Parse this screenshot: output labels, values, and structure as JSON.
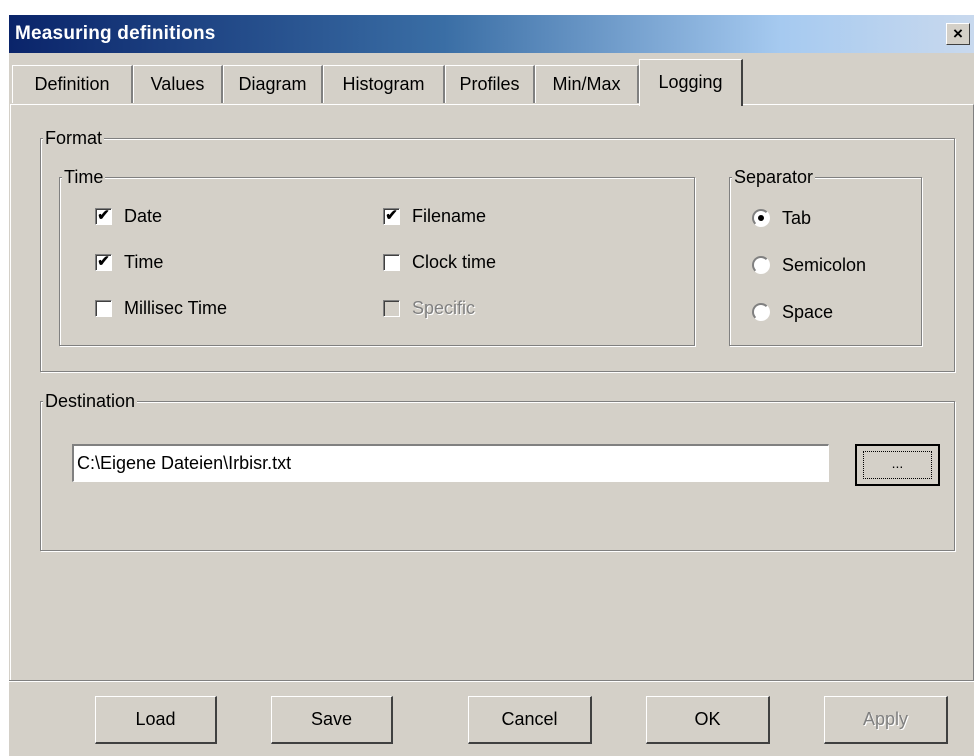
{
  "window": {
    "title": "Measuring definitions",
    "close_glyph": "×"
  },
  "tabs": [
    "Definition",
    "Values",
    "Diagram",
    "Histogram",
    "Profiles",
    "Min/Max",
    "Logging"
  ],
  "format": {
    "label": "Format",
    "time": {
      "label": "Time",
      "date": {
        "label": "Date",
        "checked": true
      },
      "time": {
        "label": "Time",
        "checked": true
      },
      "millisec": {
        "label": "Millisec Time",
        "checked": false
      },
      "filename": {
        "label": "Filename",
        "checked": true
      },
      "clock_time": {
        "label": "Clock time",
        "checked": false
      },
      "specific": {
        "label": "Specific",
        "checked": false,
        "disabled": true
      }
    },
    "separator": {
      "label": "Separator",
      "options": [
        "Tab",
        "Semicolon",
        "Space"
      ],
      "selected": "Tab"
    }
  },
  "destination": {
    "label": "Destination",
    "path": "C:\\Eigene Dateien\\Irbisr.txt",
    "browse_label": "..."
  },
  "buttons": {
    "load": "Load",
    "save": "Save",
    "cancel": "Cancel",
    "ok": "OK",
    "apply": "Apply"
  },
  "check_glyph": "✔"
}
